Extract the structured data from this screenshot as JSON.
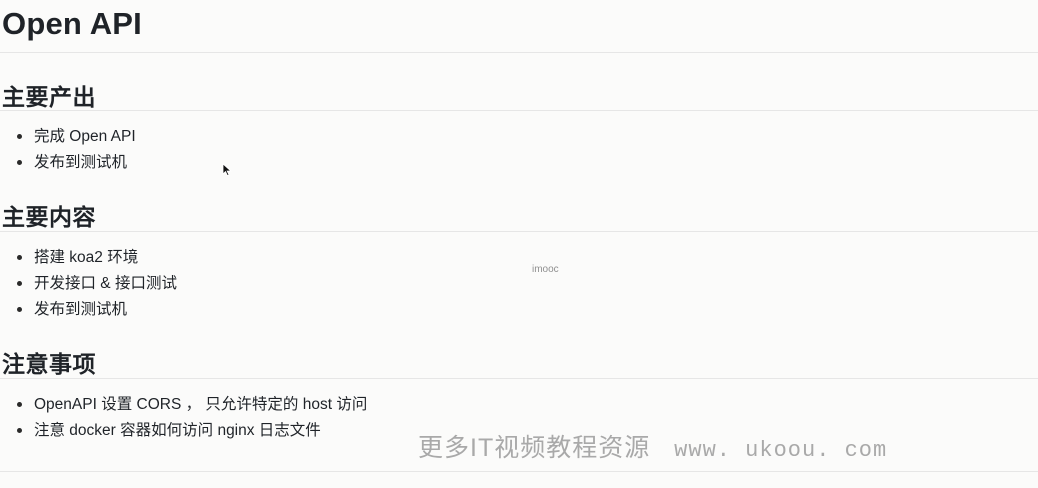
{
  "page": {
    "title": "Open API"
  },
  "sections": [
    {
      "heading": "主要产出",
      "items": [
        "完成 Open API",
        "发布到测试机"
      ]
    },
    {
      "heading": "主要内容",
      "items": [
        "搭建 koa2 环境",
        "开发接口 & 接口测试",
        "发布到测试机"
      ]
    },
    {
      "heading": "注意事项",
      "items": [
        "OpenAPI 设置 CORS ， 只允许特定的 host 访问",
        "注意 docker 容器如何访问 nginx 日志文件"
      ]
    }
  ],
  "overlay": {
    "imooc_text": "imooc",
    "watermark_text": "更多IT视频教程资源",
    "watermark_site": "www. ukoou. com"
  },
  "colors": {
    "background": "#fbfbfa",
    "text": "#1f2328",
    "rule": "#e6e6e6",
    "watermark": "#a9a9a9"
  },
  "icons": {
    "cursor": "mouse-pointer-icon"
  }
}
